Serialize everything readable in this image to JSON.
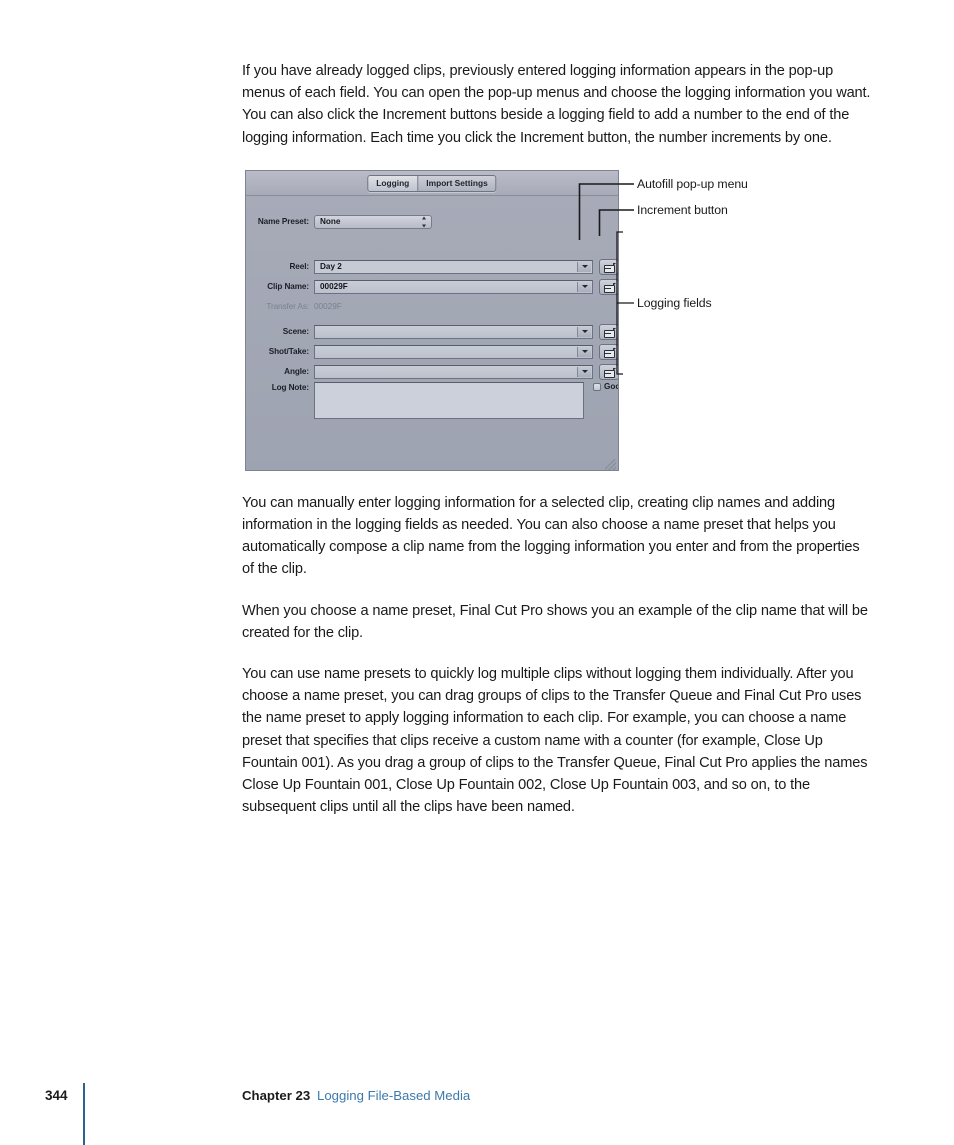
{
  "body_paragraphs": [
    "If you have already logged clips, previously entered logging information appears in the pop-up menus of each field. You can open the pop-up menus and choose the logging information you want. You can also click the Increment buttons beside a logging field to add a number to the end of the logging information. Each time you click the Increment button, the number increments by one.",
    "You can manually enter logging information for a selected clip, creating clip names and adding information in the logging fields as needed. You can also choose a name preset that helps you automatically compose a clip name from the logging information you enter and from the properties of the clip.",
    "When you choose a name preset, Final Cut Pro shows you an example of the clip name that will be created for the clip.",
    "You can use name presets to quickly log multiple clips without logging them individually. After you choose a name preset, you can drag groups of clips to the Transfer Queue and Final Cut Pro uses the name preset to apply logging information to each clip. For example, you can choose a name preset that specifies that clips receive a custom name with a counter (for example, Close Up Fountain 001). As you drag a group of clips to the Transfer Queue, Final Cut Pro applies the names Close Up Fountain 001, Close Up Fountain 002, Close Up Fountain 003, and so on, to the subsequent clips until all the clips have been named."
  ],
  "figure": {
    "tabs": [
      {
        "label": "Logging",
        "active": true
      },
      {
        "label": "Import Settings",
        "active": false
      }
    ],
    "name_preset": {
      "label": "Name Preset:",
      "value": "None"
    },
    "fields": [
      {
        "label": "Reel:",
        "value": "Day 2"
      },
      {
        "label": "Clip Name:",
        "value": "00029F"
      },
      {
        "label": "Scene:",
        "value": ""
      },
      {
        "label": "Shot/Take:",
        "value": ""
      },
      {
        "label": "Angle:",
        "value": ""
      }
    ],
    "transfer_as": {
      "label": "Transfer As:",
      "value": "00029F"
    },
    "log_note": {
      "label": "Log Note:",
      "value": ""
    },
    "good_checkbox": {
      "label": "Good",
      "checked": false
    },
    "callouts": [
      {
        "text": "Autofill pop-up menu"
      },
      {
        "text": "Increment button"
      },
      {
        "text": "Logging fields"
      }
    ]
  },
  "footer": {
    "page_number": "344",
    "chapter": "Chapter 23",
    "chapter_title": "Logging File-Based Media"
  },
  "colors": {
    "link": "#3d79ab",
    "rule": "#2d6189",
    "panel_bg": "#a5a9b6"
  }
}
